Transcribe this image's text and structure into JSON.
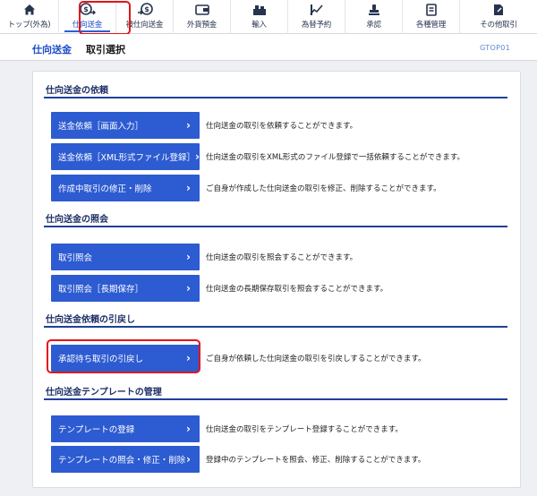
{
  "nav": {
    "items": [
      {
        "label": "トップ(外為)",
        "icon": "home-icon"
      },
      {
        "label": "仕向送金",
        "icon": "remittance-out-icon"
      },
      {
        "label": "被仕向送金",
        "icon": "remittance-in-icon"
      },
      {
        "label": "外貨預金",
        "icon": "foreign-deposit-icon"
      },
      {
        "label": "輸入",
        "icon": "import-icon"
      },
      {
        "label": "為替予約",
        "icon": "exchange-reservation-icon"
      },
      {
        "label": "承認",
        "icon": "approval-icon"
      },
      {
        "label": "各種管理",
        "icon": "management-icon"
      },
      {
        "label": "その他取引",
        "icon": "other-transactions-icon"
      }
    ],
    "active_index": 1
  },
  "header": {
    "section": "仕向送金",
    "page_title": "取引選択",
    "screen_id": "GTOP01"
  },
  "sections": [
    {
      "title": "仕向送金の依頼",
      "items": [
        {
          "label": "送金依頼［画面入力］",
          "desc": "仕向送金の取引を依頼することができます。"
        },
        {
          "label": "送金依頼［XML形式ファイル登録］",
          "desc": "仕向送金の取引をXML形式のファイル登録で一括依頼することができます。"
        },
        {
          "label": "作成中取引の修正・削除",
          "desc": "ご自身が作成した仕向送金の取引を修正、削除することができます。"
        }
      ]
    },
    {
      "title": "仕向送金の照会",
      "items": [
        {
          "label": "取引照会",
          "desc": "仕向送金の取引を照会することができます。"
        },
        {
          "label": "取引照会［長期保存］",
          "desc": "仕向送金の長期保存取引を照会することができます。"
        }
      ]
    },
    {
      "title": "仕向送金依頼の引戻し",
      "items": [
        {
          "label": "承認待ち取引の引戻し",
          "desc": "ご自身が依頼した仕向送金の取引を引戻しすることができます。"
        }
      ]
    },
    {
      "title": "仕向送金テンプレートの管理",
      "items": [
        {
          "label": "テンプレートの登録",
          "desc": "仕向送金の取引をテンプレート登録することができます。"
        },
        {
          "label": "テンプレートの照会・修正・削除",
          "desc": "登録中のテンプレートを照会、修正、削除することができます。"
        }
      ]
    }
  ],
  "colors": {
    "accent": "#2d5bd1",
    "section_rule": "#1f3f9a",
    "highlight": "#e0161e"
  }
}
